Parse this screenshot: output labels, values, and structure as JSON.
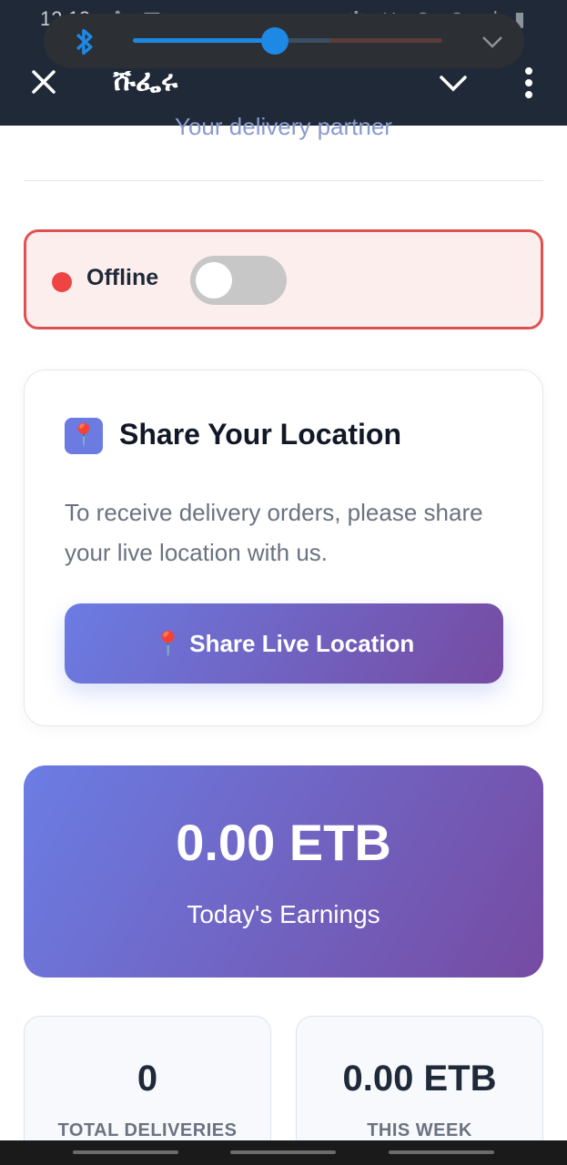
{
  "status_bar": {
    "time": "12:13",
    "icons_left": [
      "fan-icon",
      "image-icon",
      "whatsapp-icon",
      "dot-icon"
    ],
    "icons_right": [
      "bluetooth-icon",
      "mute-icon",
      "location-icon",
      "wifi-icon",
      "signal-icon",
      "battery-icon"
    ]
  },
  "volume_panel": {
    "icon": "bluetooth-icon",
    "level_percent": 46
  },
  "header": {
    "title": "ሹፌሩ",
    "close_icon": "close-icon",
    "collapse_icon": "chevron-down-icon",
    "menu_icon": "more-vertical-icon"
  },
  "subtitle": "Your delivery partner",
  "availability": {
    "label": "Offline",
    "online": false,
    "accent": "#ef4444"
  },
  "location_card": {
    "icon": "📍",
    "title": "Share Your Location",
    "description": "To receive delivery orders, please share your live location with us.",
    "button_label": "📍 Share Live Location"
  },
  "earnings": {
    "amount": "0.00 ETB",
    "label": "Today's Earnings"
  },
  "stats": [
    {
      "value": "0",
      "label": "TOTAL DELIVERIES"
    },
    {
      "value": "0.00 ETB",
      "label": "THIS WEEK"
    }
  ],
  "colors": {
    "header_bg": "#1f2937",
    "gradient_start": "#6b7ce3",
    "gradient_end": "#764ba2",
    "offline_border": "#e05252"
  }
}
